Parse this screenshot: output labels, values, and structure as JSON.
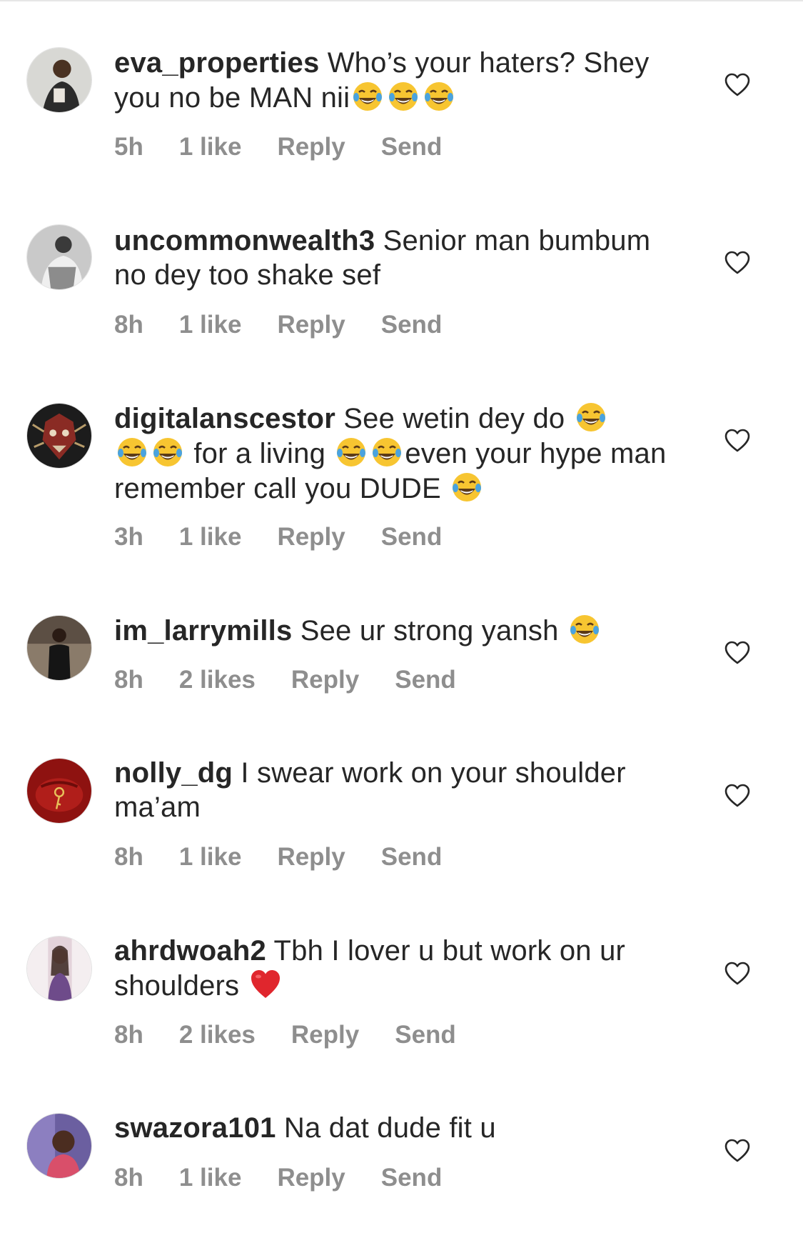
{
  "comments": [
    {
      "username": "eva_properties",
      "text_parts": [
        " Who’s your haters? Shey you no be MAN nii",
        "",
        "",
        ""
      ],
      "emojis": [
        "face-with-tears-of-joy",
        "face-with-tears-of-joy",
        "face-with-tears-of-joy"
      ],
      "time": "5h",
      "likes": "1 like",
      "reply": "Reply",
      "send": "Send"
    },
    {
      "username": "uncommonwealth3",
      "text_parts": [
        " Senior man bumbum no dey too shake sef"
      ],
      "emojis": [],
      "time": "8h",
      "likes": "1 like",
      "reply": "Reply",
      "send": "Send"
    },
    {
      "username": "digitalanscestor",
      "text_parts": [
        " See wetin dey do ",
        "",
        " for a living ",
        "",
        "even your hype man remember call you DUDE ",
        ""
      ],
      "emojis": [
        "face-with-tears-of-joy",
        "face-with-tears-of-joy",
        "face-with-tears-of-joy",
        "face-with-tears-of-joy",
        "face-with-tears-of-joy",
        "face-with-tears-of-joy"
      ],
      "time": "3h",
      "likes": "1 like",
      "reply": "Reply",
      "send": "Send"
    },
    {
      "username": "im_larrymills",
      "text_parts": [
        " See ur strong yansh "
      ],
      "emojis": [
        "face-with-tears-of-joy"
      ],
      "time": "8h",
      "likes": "2 likes",
      "reply": "Reply",
      "send": "Send"
    },
    {
      "username": "nolly_dg",
      "text_parts": [
        " I swear work on your shoulder ma’am"
      ],
      "emojis": [],
      "time": "8h",
      "likes": "1 like",
      "reply": "Reply",
      "send": "Send"
    },
    {
      "username": "ahrdwoah2",
      "text_parts": [
        " Tbh I lover u but work on ur shoulders "
      ],
      "emojis": [
        "red-heart"
      ],
      "time": "8h",
      "likes": "2 likes",
      "reply": "Reply",
      "send": "Send"
    },
    {
      "username": "swazora101",
      "text_parts": [
        " Na dat dude fit u"
      ],
      "emojis": [],
      "time": "8h",
      "likes": "1 like",
      "reply": "Reply",
      "send": "Send"
    }
  ],
  "colors": {
    "text": "#262626",
    "meta": "#8e8e8e",
    "heart_outline": "#262626",
    "emoji_face": "#f7c531",
    "emoji_tears": "#4aa3df",
    "red_heart": "#e0262d"
  },
  "icons": {
    "like": "heart-outline-icon",
    "avatar": "avatar-photo"
  }
}
